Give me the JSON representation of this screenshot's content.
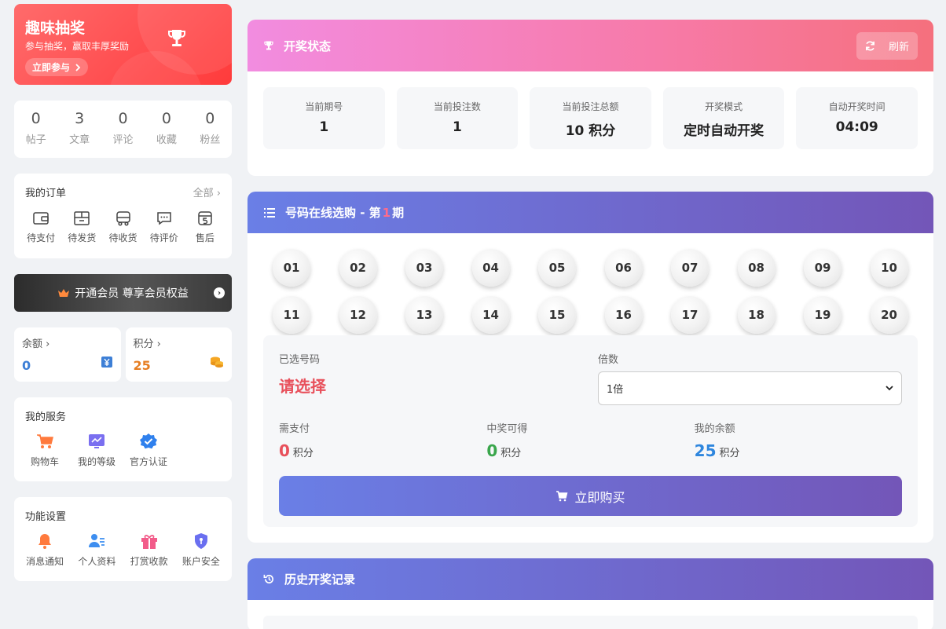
{
  "promo": {
    "title": "趣味抽奖",
    "subtitle": "参与抽奖，赢取丰厚奖励",
    "cta": "立即参与"
  },
  "stats": [
    {
      "value": "0",
      "label": "帖子"
    },
    {
      "value": "3",
      "label": "文章"
    },
    {
      "value": "0",
      "label": "评论"
    },
    {
      "value": "0",
      "label": "收藏"
    },
    {
      "value": "0",
      "label": "粉丝"
    }
  ],
  "orders": {
    "title": "我的订单",
    "more": "全部",
    "items": [
      {
        "label": "待支付",
        "icon": "wallet-icon"
      },
      {
        "label": "待发货",
        "icon": "package-icon"
      },
      {
        "label": "待收货",
        "icon": "truck-icon"
      },
      {
        "label": "待评价",
        "icon": "comment-icon"
      },
      {
        "label": "售后",
        "icon": "after-sales-icon"
      }
    ]
  },
  "vip": {
    "label": "开通会员 尊享会员权益"
  },
  "wallet": {
    "balance": {
      "label": "余额",
      "value": "0",
      "color": "#3d7fd6"
    },
    "points": {
      "label": "积分",
      "value": "25",
      "color": "#e67e22"
    }
  },
  "services": {
    "title": "我的服务",
    "items": [
      {
        "label": "购物车",
        "icon": "cart-icon"
      },
      {
        "label": "我的等级",
        "icon": "level-icon"
      },
      {
        "label": "官方认证",
        "icon": "verified-icon"
      }
    ]
  },
  "settings": {
    "title": "功能设置",
    "items": [
      {
        "label": "消息通知",
        "icon": "bell-icon"
      },
      {
        "label": "个人资料",
        "icon": "profile-icon"
      },
      {
        "label": "打赏收款",
        "icon": "gift-icon"
      },
      {
        "label": "账户安全",
        "icon": "shield-icon"
      }
    ]
  },
  "draw_status": {
    "title": "开奖状态",
    "refresh": "刷新",
    "boxes": [
      {
        "label": "当前期号",
        "value": "1"
      },
      {
        "label": "当前投注数",
        "value": "1"
      },
      {
        "label": "当前投注总额",
        "value": "10 积分"
      },
      {
        "label": "开奖模式",
        "value": "定时自动开奖"
      },
      {
        "label": "自动开奖时间",
        "value": "04:09"
      }
    ]
  },
  "picker": {
    "title_prefix": "号码在线选购 - 第",
    "period": "1",
    "title_suffix": "期",
    "numbers": [
      "01",
      "02",
      "03",
      "04",
      "05",
      "06",
      "07",
      "08",
      "09",
      "10",
      "11",
      "12",
      "13",
      "14",
      "15",
      "16",
      "17",
      "18",
      "19",
      "20"
    ],
    "selected_label": "已选号码",
    "selected_value": "请选择",
    "multiplier_label": "倍数",
    "multiplier_value": "1倍",
    "pay_label": "需支付",
    "pay_value": "0",
    "win_label": "中奖可得",
    "win_value": "0",
    "balance_label": "我的余额",
    "balance_value": "25",
    "unit": "积分",
    "buy_button": "立即购买",
    "colors": {
      "pay": "#e8505b",
      "win": "#3aa64c",
      "balance": "#2e86de"
    }
  },
  "history": {
    "title": "历史开奖记录"
  }
}
